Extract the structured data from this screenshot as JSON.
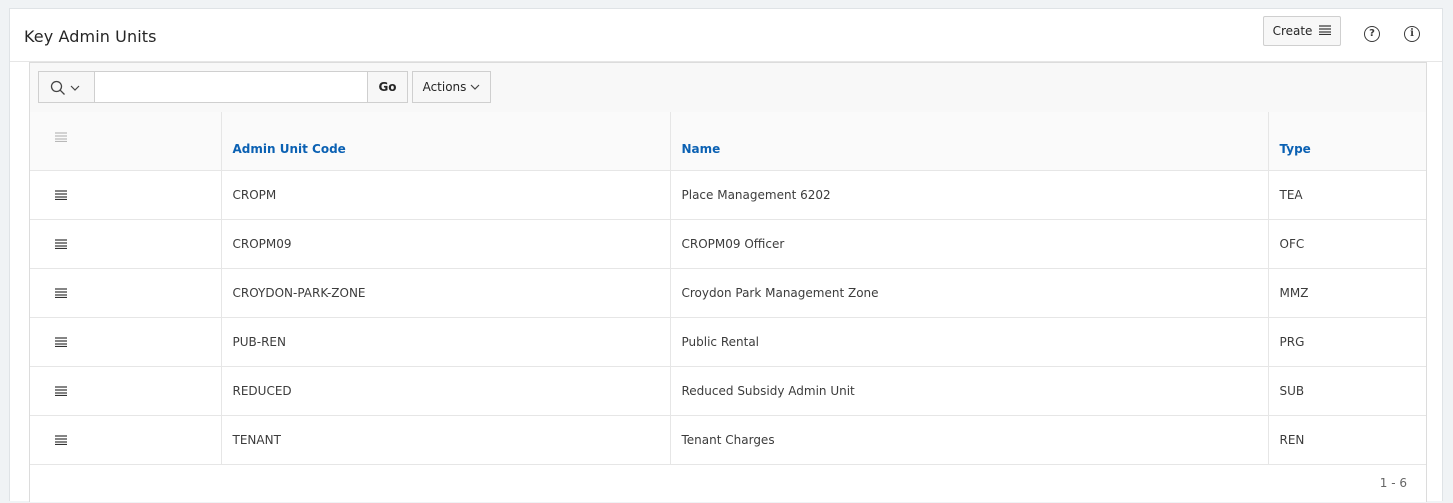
{
  "region": {
    "title": "Key Admin Units",
    "create_label": "Create",
    "help_label": "?",
    "info_label": "i"
  },
  "toolbar": {
    "search_placeholder": "",
    "go_label": "Go",
    "actions_label": "Actions"
  },
  "table": {
    "columns": [
      "Admin Unit Code",
      "Name",
      "Type"
    ],
    "rows": [
      {
        "code": "CROPM",
        "name": "Place Management 6202",
        "type": "TEA"
      },
      {
        "code": "CROPM09",
        "name": "CROPM09 Officer",
        "type": "OFC"
      },
      {
        "code": "CROYDON-PARK-ZONE",
        "name": "Croydon Park Management Zone",
        "type": "MMZ"
      },
      {
        "code": "PUB-REN",
        "name": "Public Rental",
        "type": "PRG"
      },
      {
        "code": "REDUCED",
        "name": "Reduced Subsidy Admin Unit",
        "type": "SUB"
      },
      {
        "code": "TENANT",
        "name": "Tenant Charges",
        "type": "REN"
      }
    ]
  },
  "pagination": {
    "range": "1 - 6"
  },
  "colors": {
    "link": "#0b61b3",
    "border": "#e6e6e6",
    "background": "#f0f3f5"
  }
}
